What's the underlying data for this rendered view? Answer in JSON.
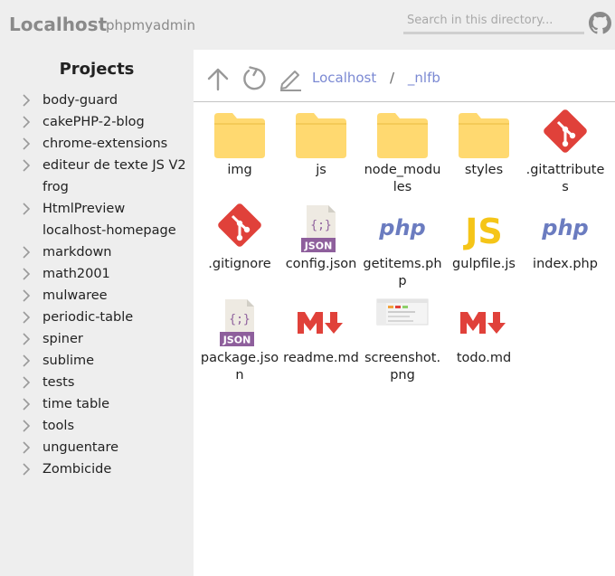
{
  "header": {
    "brand": "Localhost",
    "link": "phpmyadmin",
    "search_placeholder": "Search in this directory...",
    "github_icon": "github-icon"
  },
  "sidebar": {
    "title": "Projects",
    "items": [
      {
        "label": "body-guard",
        "expandable": true
      },
      {
        "label": "cakePHP-2-blog",
        "expandable": true
      },
      {
        "label": "chrome-extensions",
        "expandable": true
      },
      {
        "label": "editeur de texte JS V2",
        "expandable": true
      },
      {
        "label": "frog",
        "expandable": false
      },
      {
        "label": "HtmlPreview",
        "expandable": true
      },
      {
        "label": "localhost-homepage",
        "expandable": false
      },
      {
        "label": "markdown",
        "expandable": true
      },
      {
        "label": "math2001",
        "expandable": true
      },
      {
        "label": "mulwaree",
        "expandable": true
      },
      {
        "label": "periodic-table",
        "expandable": true
      },
      {
        "label": "spiner",
        "expandable": true
      },
      {
        "label": "sublime",
        "expandable": true
      },
      {
        "label": "tests",
        "expandable": true
      },
      {
        "label": "time table",
        "expandable": true
      },
      {
        "label": "tools",
        "expandable": true
      },
      {
        "label": "unguentare",
        "expandable": true
      },
      {
        "label": "Zombicide",
        "expandable": true
      }
    ]
  },
  "toolbar": {
    "up_icon": "arrow-up-icon",
    "refresh_icon": "refresh-icon",
    "edit_icon": "pencil-icon"
  },
  "breadcrumb": {
    "items": [
      "Localhost",
      "_nlfb"
    ],
    "separator": "/"
  },
  "files": [
    {
      "name": "img",
      "type": "folder"
    },
    {
      "name": "js",
      "type": "folder"
    },
    {
      "name": "node_modules",
      "type": "folder"
    },
    {
      "name": "styles",
      "type": "folder"
    },
    {
      "name": ".gitattributes",
      "type": "git"
    },
    {
      "name": ".gitignore",
      "type": "git"
    },
    {
      "name": "config.json",
      "type": "json"
    },
    {
      "name": "getitems.php",
      "type": "php"
    },
    {
      "name": "gulpfile.js",
      "type": "js"
    },
    {
      "name": "index.php",
      "type": "php"
    },
    {
      "name": "package.json",
      "type": "json"
    },
    {
      "name": "readme.md",
      "type": "md"
    },
    {
      "name": "screenshot.png",
      "type": "image"
    },
    {
      "name": "todo.md",
      "type": "md"
    }
  ],
  "colors": {
    "folder": "#ffd970",
    "git": "#e0413a",
    "php": "#6b7cc0",
    "js": "#f5c518",
    "markdown": "#e0413a",
    "json_label": "#8e5f9c",
    "link": "#7b89d3"
  }
}
